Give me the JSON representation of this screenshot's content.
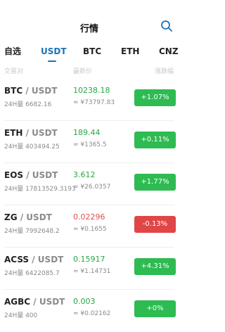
{
  "header": {
    "title": "行情",
    "search_icon": "search-icon"
  },
  "tabs": [
    {
      "label": "自选"
    },
    {
      "label": "USDT",
      "active": true
    },
    {
      "label": "BTC"
    },
    {
      "label": "ETH"
    },
    {
      "label": "CNZ"
    }
  ],
  "columns": {
    "pair": "交易对",
    "price": "最新价",
    "change": "涨跌幅"
  },
  "rows": [
    {
      "base": "BTC",
      "quote": " / USDT",
      "volume": "24H量 6682.16",
      "price": "10238.18",
      "cny": "≈ ¥73797.83",
      "change": "+1.07%",
      "direction": "up"
    },
    {
      "base": "ETH",
      "quote": " / USDT",
      "volume": "24H量 403494.25",
      "price": "189.44",
      "cny": "≈ ¥1365.5",
      "change": "+0.11%",
      "direction": "up"
    },
    {
      "base": "EOS",
      "quote": " / USDT",
      "volume": "24H量 17813529.3193",
      "price": "3.612",
      "cny": "≈ ¥26.0357",
      "change": "+1.77%",
      "direction": "up"
    },
    {
      "base": "ZG",
      "quote": " / USDT",
      "volume": "24H量 7992648.2",
      "price": "0.02296",
      "cny": "≈ ¥0.1655",
      "change": "-0.13%",
      "direction": "down"
    },
    {
      "base": "ACSS",
      "quote": " / USDT",
      "volume": "24H量 6422085.7",
      "price": "0.15917",
      "cny": "≈ ¥1.14731",
      "change": "+4.31%",
      "direction": "up"
    },
    {
      "base": "AGBC",
      "quote": " / USDT",
      "volume": "24H量 400",
      "price": "0.003",
      "cny": "≈ ¥0.02162",
      "change": "+0%",
      "direction": "up"
    }
  ],
  "colors": {
    "accent": "#1a73b8",
    "up": "#2dbb52",
    "down": "#e04646"
  }
}
